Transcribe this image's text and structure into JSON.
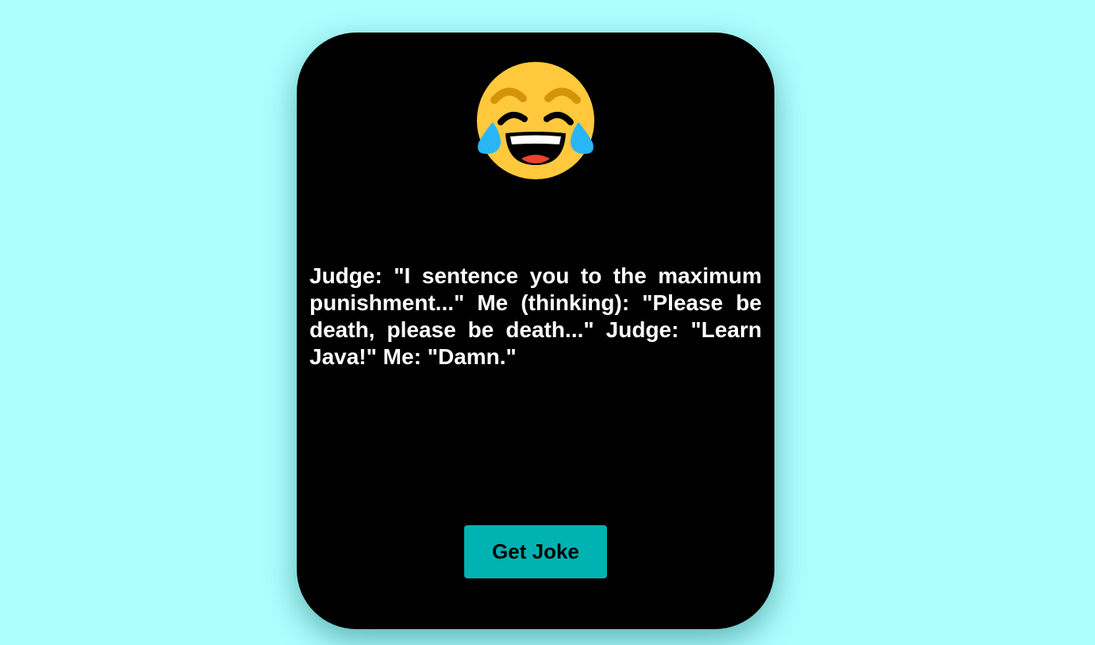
{
  "card": {
    "icon": "face-with-tears-of-joy-icon",
    "joke_text": "Judge: \"I sentence you to the maximum punishment...\" Me (thinking): \"Please be death, please be death...\" Judge: \"Learn Java!\" Me: \"Damn.\"",
    "button_label": "Get Joke"
  },
  "colors": {
    "background": "#aefefe",
    "card": "#000000",
    "button": "#00b2b2",
    "text": "#ffffff"
  }
}
